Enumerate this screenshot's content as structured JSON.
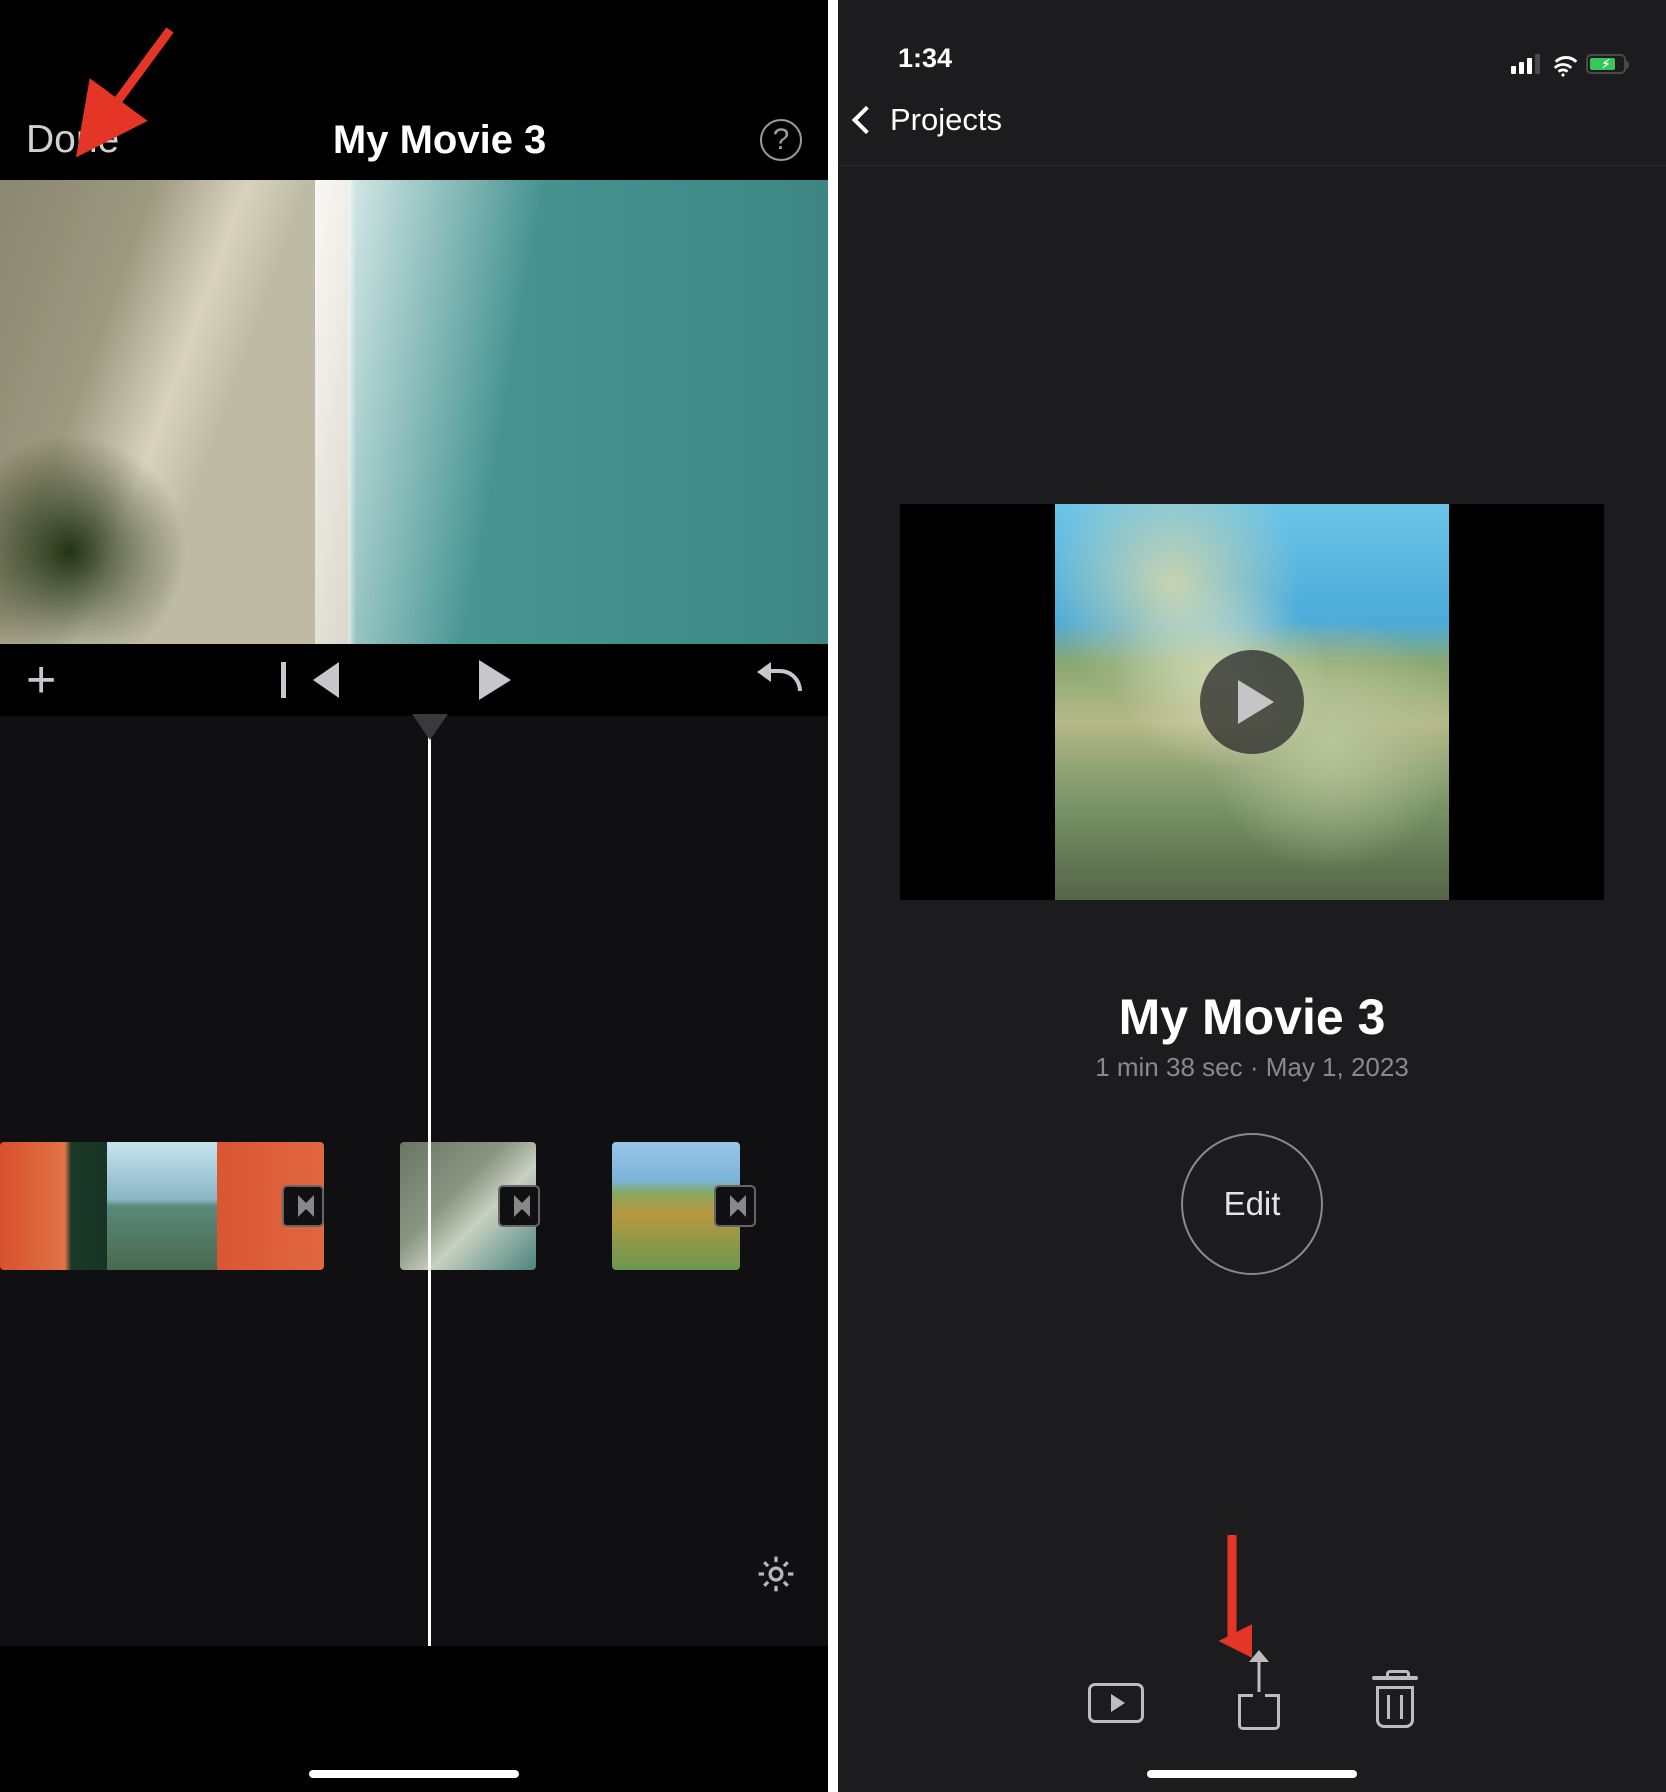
{
  "left": {
    "nav": {
      "done": "Done",
      "title": "My Movie 3"
    },
    "help_glyph": "?",
    "controls": {
      "add": "+"
    },
    "icons": {
      "skip_start": "skip-to-start",
      "play": "play",
      "undo": "undo",
      "gear": "settings-gear",
      "plus": "add",
      "help": "help"
    },
    "timeline": {
      "clips": [
        {
          "id": "clip-1"
        },
        {
          "id": "clip-2"
        },
        {
          "id": "clip-3"
        }
      ],
      "transitions": 3
    },
    "annotation": {
      "target": "done-button",
      "color": "#e53526"
    }
  },
  "right": {
    "status": {
      "time": "1:34",
      "battery_charging": true,
      "battery_color": "#35c759"
    },
    "nav": {
      "back_label": "Projects"
    },
    "project": {
      "title": "My Movie 3",
      "duration_date": "1 min 38 sec · May 1, 2023",
      "edit_label": "Edit"
    },
    "toolbar_icons": {
      "play": "play-preview",
      "share": "share",
      "trash": "delete"
    },
    "annotation": {
      "target": "share-button",
      "color": "#e53526"
    }
  }
}
